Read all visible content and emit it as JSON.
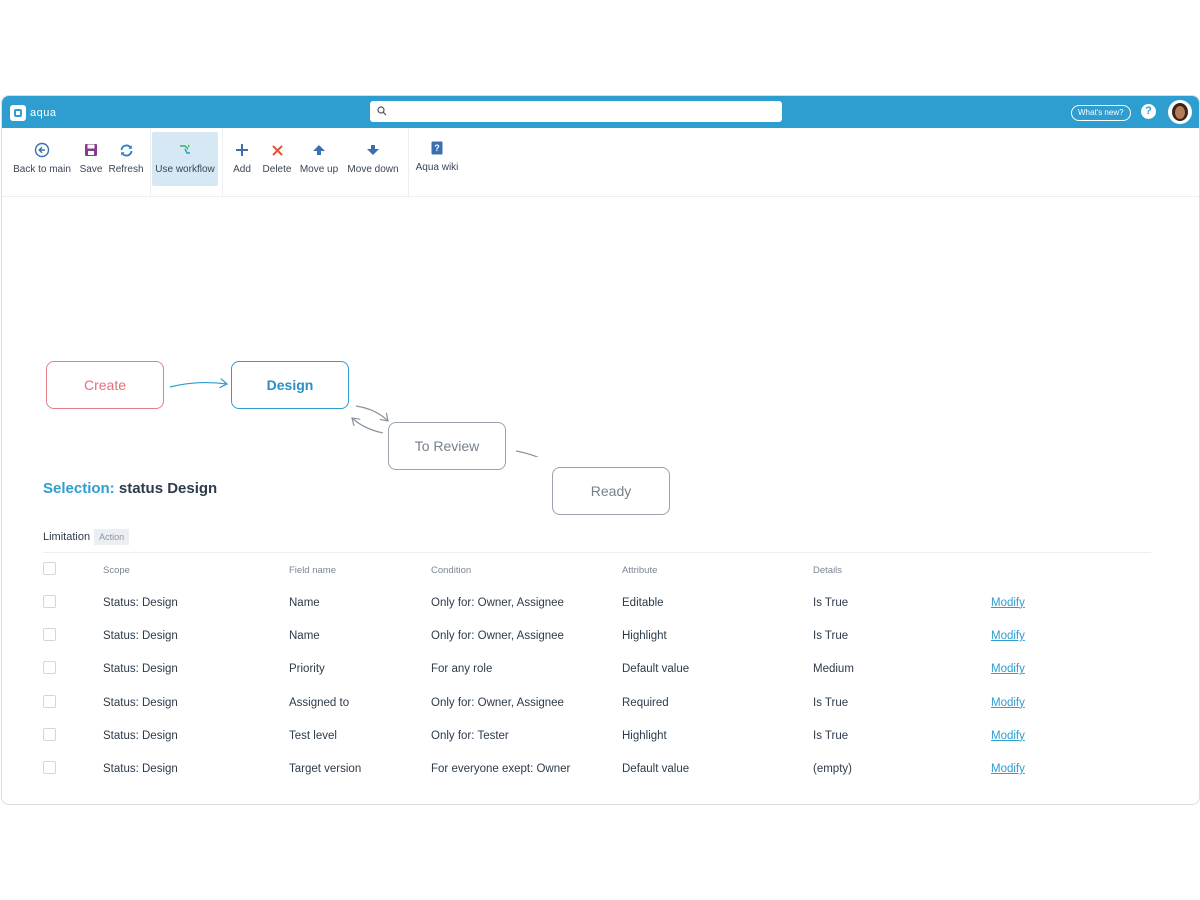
{
  "app": {
    "logo_text": "aqua"
  },
  "topbar": {
    "search_placeholder": "",
    "whats_new": "What's new?",
    "help": "?"
  },
  "toolbar": {
    "back": "Back to main",
    "save": "Save",
    "refresh": "Refresh",
    "use_workflow": "Use workflow",
    "add": "Add",
    "delete": "Delete",
    "move_up": "Move up",
    "move_down": "Move down",
    "wiki": "Aqua wiki"
  },
  "workflow": {
    "nodes": {
      "create": "Create",
      "design": "Design",
      "review": "To Review",
      "ready": "Ready"
    }
  },
  "selection": {
    "prefix": "Selection:",
    "value": "status Design"
  },
  "tabs": {
    "limitation": "Limitation",
    "action": "Action"
  },
  "table": {
    "headers": {
      "scope": "Scope",
      "field": "Field name",
      "condition": "Condition",
      "attribute": "Attribute",
      "details": "Details"
    },
    "rows": [
      {
        "scope": "Status: Design",
        "field": "Name",
        "condition": "Only for: Owner, Assignee",
        "attribute": "Editable",
        "details": "Is True",
        "action": "Modify"
      },
      {
        "scope": "Status: Design",
        "field": "Name",
        "condition": "Only for: Owner, Assignee",
        "attribute": "Highlight",
        "details": "Is True",
        "action": "Modify"
      },
      {
        "scope": "Status: Design",
        "field": "Priority",
        "condition": "For any role",
        "attribute": "Default value",
        "details": "Medium",
        "action": "Modify"
      },
      {
        "scope": "Status: Design",
        "field": "Assigned to",
        "condition": "Only for: Owner, Assignee",
        "attribute": "Required",
        "details": "Is True",
        "action": "Modify"
      },
      {
        "scope": "Status: Design",
        "field": "Test level",
        "condition": "Only for: Tester",
        "attribute": "Highlight",
        "details": "Is True",
        "action": "Modify"
      },
      {
        "scope": "Status: Design",
        "field": "Target version",
        "condition": "For everyone exept: Owner",
        "attribute": "Default value",
        "details": "(empty)",
        "action": "Modify"
      }
    ]
  },
  "colors": {
    "topbar": "#2e9dd0",
    "accent": "#2e9dd0",
    "create": "#e2707b",
    "inactive": "#9aa3ae"
  }
}
